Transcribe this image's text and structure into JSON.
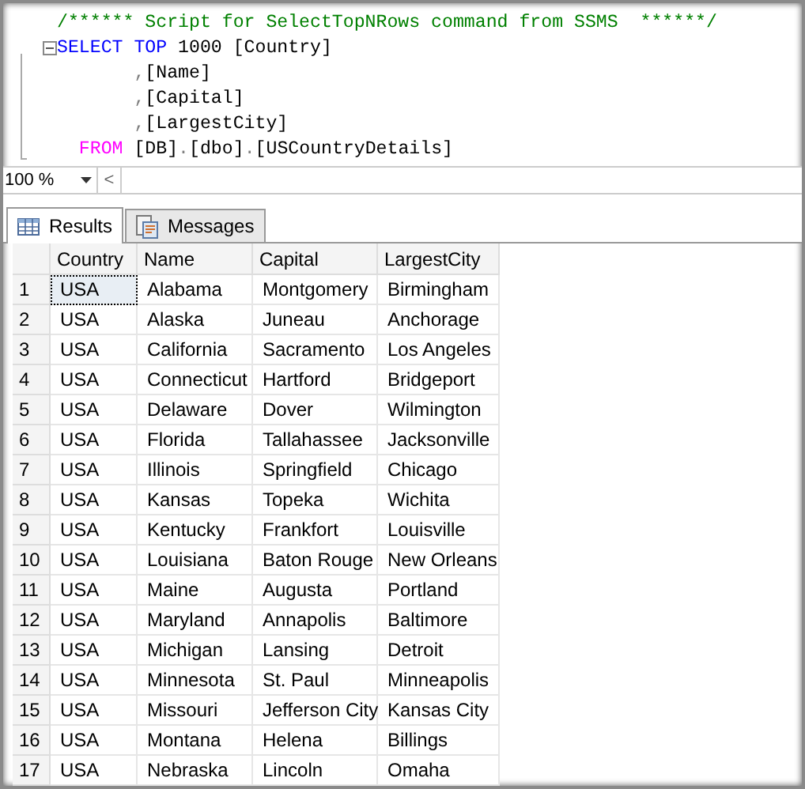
{
  "editor": {
    "lines": [
      {
        "collapsible": false,
        "segments": [
          {
            "kind": "comment",
            "text": "/****** Script for SelectTopNRows command from SSMS  ******/"
          }
        ]
      },
      {
        "collapsible": true,
        "segments": [
          {
            "kind": "keyword",
            "text": "SELECT TOP"
          },
          {
            "kind": "plain",
            "text": " 1000 [Country]"
          }
        ]
      },
      {
        "collapsible": false,
        "segments": [
          {
            "kind": "punct",
            "text": "       ,"
          },
          {
            "kind": "plain",
            "text": "[Name]"
          }
        ]
      },
      {
        "collapsible": false,
        "segments": [
          {
            "kind": "punct",
            "text": "       ,"
          },
          {
            "kind": "plain",
            "text": "[Capital]"
          }
        ]
      },
      {
        "collapsible": false,
        "segments": [
          {
            "kind": "punct",
            "text": "       ,"
          },
          {
            "kind": "plain",
            "text": "[LargestCity]"
          }
        ]
      },
      {
        "collapsible": false,
        "segments": [
          {
            "kind": "keyword2",
            "text": "  FROM"
          },
          {
            "kind": "plain",
            "text": " [DB]"
          },
          {
            "kind": "punct",
            "text": "."
          },
          {
            "kind": "plain",
            "text": "[dbo]"
          },
          {
            "kind": "punct",
            "text": "."
          },
          {
            "kind": "plain",
            "text": "[USCountryDetails]"
          }
        ]
      }
    ]
  },
  "zoom": {
    "value": "100 %",
    "scroll_left": "<"
  },
  "tabs": [
    {
      "label": "Results",
      "selected": true,
      "kind": "grid"
    },
    {
      "label": "Messages",
      "selected": false,
      "kind": "messages"
    }
  ],
  "table": {
    "columns": [
      "Country",
      "Name",
      "Capital",
      "LargestCity"
    ],
    "rows": [
      {
        "number": "1",
        "focused": true,
        "cells": [
          "USA",
          "Alabama",
          "Montgomery",
          "Birmingham"
        ]
      },
      {
        "number": "2",
        "focused": false,
        "cells": [
          "USA",
          "Alaska",
          "Juneau",
          "Anchorage"
        ]
      },
      {
        "number": "3",
        "focused": false,
        "cells": [
          "USA",
          "California",
          "Sacramento",
          "Los Angeles"
        ]
      },
      {
        "number": "4",
        "focused": false,
        "cells": [
          "USA",
          "Connecticut",
          "Hartford",
          "Bridgeport"
        ]
      },
      {
        "number": "5",
        "focused": false,
        "cells": [
          "USA",
          "Delaware",
          "Dover",
          "Wilmington"
        ]
      },
      {
        "number": "6",
        "focused": false,
        "cells": [
          "USA",
          "Florida",
          "Tallahassee",
          "Jacksonville"
        ]
      },
      {
        "number": "7",
        "focused": false,
        "cells": [
          "USA",
          "Illinois",
          "Springfield",
          "Chicago"
        ]
      },
      {
        "number": "8",
        "focused": false,
        "cells": [
          "USA",
          "Kansas",
          "Topeka",
          "Wichita"
        ]
      },
      {
        "number": "9",
        "focused": false,
        "cells": [
          "USA",
          "Kentucky",
          "Frankfort",
          "Louisville"
        ]
      },
      {
        "number": "10",
        "focused": false,
        "cells": [
          "USA",
          "Louisiana",
          "Baton Rouge",
          "New Orleans"
        ]
      },
      {
        "number": "11",
        "focused": false,
        "cells": [
          "USA",
          "Maine",
          "Augusta",
          "Portland"
        ]
      },
      {
        "number": "12",
        "focused": false,
        "cells": [
          "USA",
          "Maryland",
          "Annapolis",
          "Baltimore"
        ]
      },
      {
        "number": "13",
        "focused": false,
        "cells": [
          "USA",
          "Michigan",
          "Lansing",
          "Detroit"
        ]
      },
      {
        "number": "14",
        "focused": false,
        "cells": [
          "USA",
          "Minnesota",
          "St. Paul",
          "Minneapolis"
        ]
      },
      {
        "number": "15",
        "focused": false,
        "cells": [
          "USA",
          "Missouri",
          "Jefferson City",
          "Kansas City"
        ]
      },
      {
        "number": "16",
        "focused": false,
        "cells": [
          "USA",
          "Montana",
          "Helena",
          "Billings"
        ]
      },
      {
        "number": "17",
        "focused": false,
        "cells": [
          "USA",
          "Nebraska",
          "Lincoln",
          "Omaha"
        ]
      }
    ]
  }
}
